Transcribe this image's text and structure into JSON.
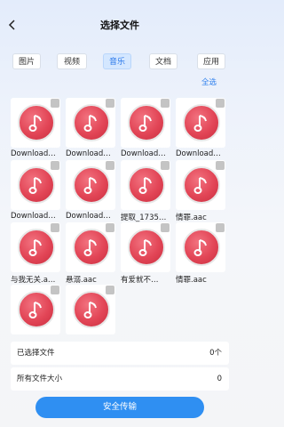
{
  "header": {
    "title": "选择文件"
  },
  "tabs": [
    {
      "label": "图片",
      "active": false
    },
    {
      "label": "视频",
      "active": false
    },
    {
      "label": "音乐",
      "active": true
    },
    {
      "label": "文档",
      "active": false
    },
    {
      "label": "应用",
      "active": false
    }
  ],
  "select_all": "全选",
  "files": [
    {
      "name": "Download…"
    },
    {
      "name": "Download…"
    },
    {
      "name": "Download…"
    },
    {
      "name": "Download…"
    },
    {
      "name": "Download…"
    },
    {
      "name": "Download…"
    },
    {
      "name": "提取_1735…"
    },
    {
      "name": "情罪.aac"
    },
    {
      "name": "与我无关.a…"
    },
    {
      "name": "悬溺.aac"
    },
    {
      "name": "有爱就不…"
    },
    {
      "name": "情罪.aac"
    },
    {
      "name": ""
    },
    {
      "name": ""
    }
  ],
  "summary": {
    "selected_label": "已选择文件",
    "selected_value": "0个",
    "size_label": "所有文件大小",
    "size_value": "0"
  },
  "submit_label": "安全传输",
  "colors": {
    "accent": "#2f8ff2",
    "tab_active_bg": "#d4e7ff",
    "disc": "#e24556"
  }
}
